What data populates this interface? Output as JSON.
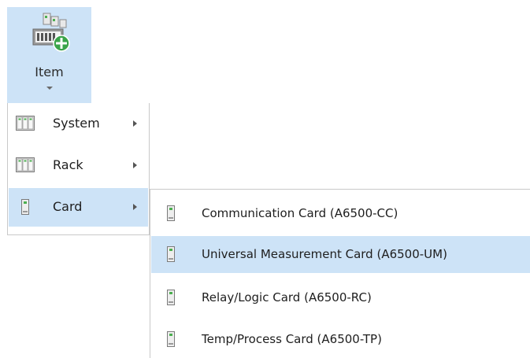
{
  "ribbon": {
    "item_button": {
      "label": "Item",
      "icon": "rack-add-icon"
    }
  },
  "item_menu": {
    "items": [
      {
        "label": "System",
        "icon": "system-grid-icon",
        "has_submenu": true,
        "selected": false
      },
      {
        "label": "Rack",
        "icon": "rack-grid-icon",
        "has_submenu": true,
        "selected": false
      },
      {
        "label": "Card",
        "icon": "card-icon",
        "has_submenu": true,
        "selected": true
      }
    ]
  },
  "card_submenu": {
    "items": [
      {
        "label": "Communication Card (A6500-CC)",
        "icon": "card-icon",
        "highlighted": false
      },
      {
        "label": "Universal Measurement Card (A6500-UM)",
        "icon": "card-icon",
        "highlighted": true
      },
      {
        "label": "Relay/Logic Card (A6500-RC)",
        "icon": "card-icon",
        "highlighted": false
      },
      {
        "label": "Temp/Process Card (A6500-TP)",
        "icon": "card-icon",
        "highlighted": false
      }
    ]
  },
  "colors": {
    "selection": "#cde3f7",
    "border": "#c9c9c9",
    "icon_green": "#3aa44a"
  }
}
